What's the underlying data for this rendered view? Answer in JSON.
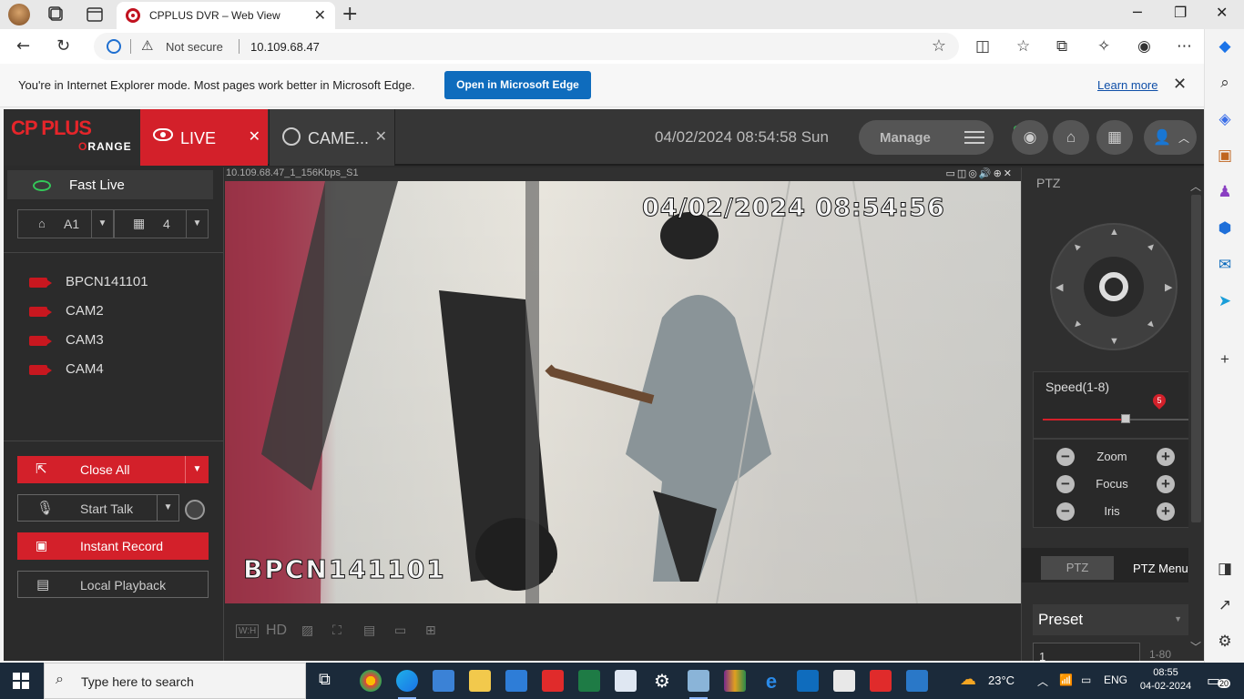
{
  "browser": {
    "tab_title": "CPPLUS DVR – Web View",
    "address": {
      "security_label": "Not secure",
      "url": "10.109.68.47"
    },
    "ie_mode_bar": {
      "message": "You're in Internet Explorer mode. Most pages work better in Microsoft Edge.",
      "open_button": "Open in Microsoft Edge",
      "learn_more": "Learn more"
    }
  },
  "dvr": {
    "logo_text": "CP PLUS",
    "logo_sub_prefix": "O",
    "logo_sub": "RANGE",
    "tabs": [
      {
        "label": "LIVE",
        "active": true
      },
      {
        "label": "CAME..."
      }
    ],
    "datetime": "04/02/2024 08:54:58 Sun",
    "manage_label": "Manage",
    "left_panel": {
      "fast_live": "Fast Live",
      "stream_select": "A1",
      "layout_select": "4",
      "cameras": [
        "BPCN141101",
        "CAM2",
        "CAM3",
        "CAM4"
      ],
      "buttons": {
        "close_all": "Close All",
        "start_talk": "Start Talk",
        "instant_record": "Instant Record",
        "local_playback": "Local Playback"
      }
    },
    "video": {
      "stream_title": "10.109.68.47_1_156Kbps_S1",
      "osd_timestamp": "04/02/2024 08:54:56",
      "osd_camera_name": "BPCN141101",
      "toolbar": {
        "aspect": "W:H",
        "quality": "HD"
      }
    },
    "ptz": {
      "heading": "PTZ",
      "speed_label": "Speed(1-8)",
      "speed_value": "5",
      "speed_fraction": 0.57,
      "zoom_label": "Zoom",
      "focus_label": "Focus",
      "iris_label": "Iris",
      "tab_ptz": "PTZ",
      "tab_ptz_menu": "PTZ Menu",
      "preset_label": "Preset",
      "preset_value": "1",
      "preset_range": "1-80"
    }
  },
  "taskbar": {
    "search_placeholder": "Type here to search",
    "weather": "23°C",
    "language": "ENG",
    "time": "08:55",
    "date": "04-02-2024",
    "notifications": "20"
  },
  "colors": {
    "accent_red": "#d3202a",
    "edge_blue": "#0f6cbd",
    "dvr_bg": "#2b2b2b"
  }
}
